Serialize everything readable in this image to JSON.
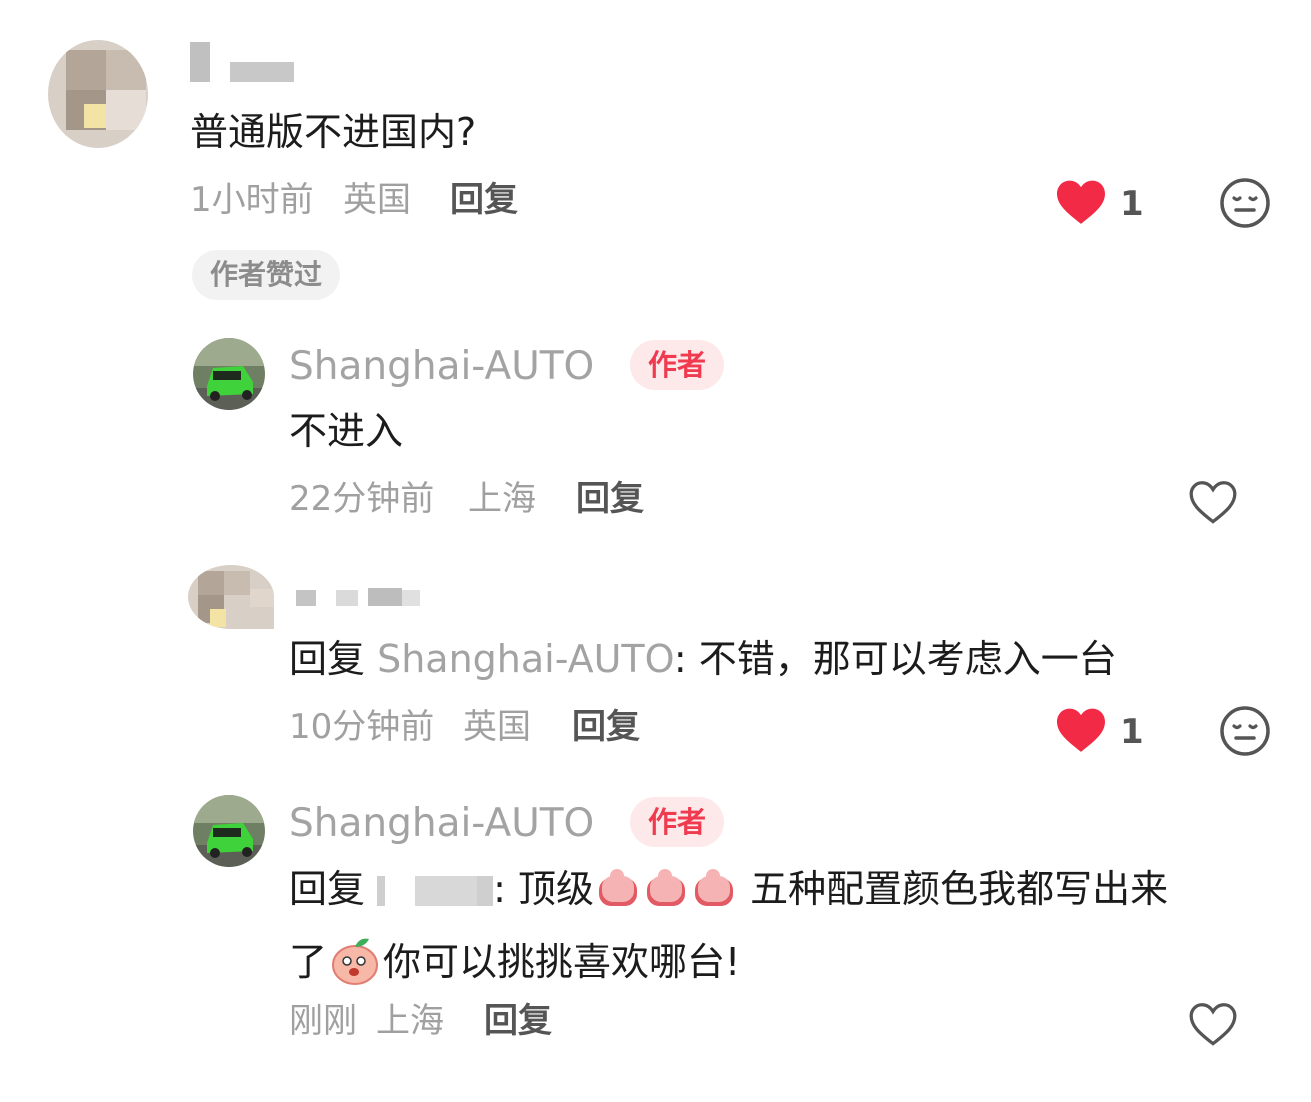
{
  "comments": [
    {
      "content": "普通版不进国内?",
      "time": "1小时前",
      "location": "英国",
      "reply_label": "回复",
      "like_count": "1",
      "author_liked": "作者赞过"
    },
    {
      "username": "Shanghai-AUTO",
      "badge": "作者",
      "content": "不进入",
      "time": "22分钟前",
      "location": "上海",
      "reply_label": "回复"
    },
    {
      "content_prefix": "回复 ",
      "mention": "Shanghai-AUTO",
      "content_rest": ": 不错，那可以考虑入一台",
      "time": "10分钟前",
      "location": "英国",
      "reply_label": "回复",
      "like_count": "1"
    },
    {
      "username": "Shanghai-AUTO",
      "badge": "作者",
      "content_prefix": "回复 ",
      "content_mid": ": 顶级",
      "content_tail": " 五种配置颜色我都写出来",
      "content_line2_a": "了",
      "content_line2_b": "你可以挑挑喜欢哪台!",
      "time": "刚刚",
      "location": "上海",
      "reply_label": "回复"
    }
  ],
  "colors": {
    "like_red": "#f22a45",
    "badge_bg": "#fde8ea",
    "badge_text": "#ef3a4f",
    "muted_text": "#a3a3a3"
  },
  "icons": [
    "heart-filled-icon",
    "heart-outline-icon",
    "dislike-face-icon",
    "thumbs-up-emoji",
    "peach-emoji"
  ]
}
